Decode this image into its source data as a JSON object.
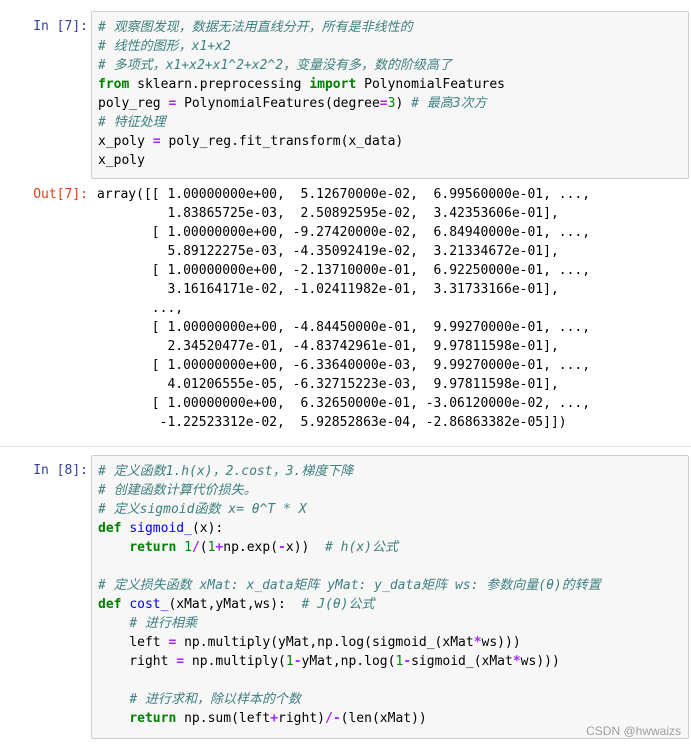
{
  "cells": [
    {
      "prompt": "In  [7]:",
      "lines": [
        [
          {
            "t": "cm",
            "v": "# 观察图发现，数据无法用直线分开，所有是非线性的"
          }
        ],
        [
          {
            "t": "cm",
            "v": "# 线性的图形，x1+x2"
          }
        ],
        [
          {
            "t": "cm",
            "v": "# 多项式，x1+x2+x1^2+x2^2，变量没有多，数的阶级高了"
          }
        ],
        [
          {
            "t": "kw",
            "v": "from"
          },
          {
            "t": "",
            "v": " sklearn.preprocessing "
          },
          {
            "t": "kw",
            "v": "import"
          },
          {
            "t": "",
            "v": " PolynomialFeatures"
          }
        ],
        [
          {
            "t": "",
            "v": "poly_reg "
          },
          {
            "t": "op",
            "v": "="
          },
          {
            "t": "",
            "v": " PolynomialFeatures(degree"
          },
          {
            "t": "op",
            "v": "="
          },
          {
            "t": "nm",
            "v": "3"
          },
          {
            "t": "",
            "v": ") "
          },
          {
            "t": "cm",
            "v": "# 最高3次方"
          }
        ],
        [
          {
            "t": "cm",
            "v": "# 特征处理"
          }
        ],
        [
          {
            "t": "",
            "v": "x_poly "
          },
          {
            "t": "op",
            "v": "="
          },
          {
            "t": "",
            "v": " poly_reg.fit_transform(x_data)"
          }
        ],
        [
          {
            "t": "",
            "v": "x_poly"
          }
        ]
      ]
    },
    {
      "prompt": "Out[7]:",
      "output": "array([[ 1.00000000e+00,  5.12670000e-02,  6.99560000e-01, ...,\n         1.83865725e-03,  2.50892595e-02,  3.42353606e-01],\n       [ 1.00000000e+00, -9.27420000e-02,  6.84940000e-01, ...,\n         5.89122275e-03, -4.35092419e-02,  3.21334672e-01],\n       [ 1.00000000e+00, -2.13710000e-01,  6.92250000e-01, ...,\n         3.16164171e-02, -1.02411982e-01,  3.31733166e-01],\n       ...,\n       [ 1.00000000e+00, -4.84450000e-01,  9.99270000e-01, ...,\n         2.34520477e-01, -4.83742961e-01,  9.97811598e-01],\n       [ 1.00000000e+00, -6.33640000e-03,  9.99270000e-01, ...,\n         4.01206555e-05, -6.32715223e-03,  9.97811598e-01],\n       [ 1.00000000e+00,  6.32650000e-01, -3.06120000e-02, ...,\n        -1.22523312e-02,  5.92852863e-04, -2.86863382e-05]])"
    },
    {
      "prompt": "In  [8]:",
      "lines": [
        [
          {
            "t": "cm",
            "v": "# 定义函数1.h(x)，2.cost，3.梯度下降"
          }
        ],
        [
          {
            "t": "cm",
            "v": "# 创建函数计算代价损失。"
          }
        ],
        [
          {
            "t": "cm",
            "v": "# 定义sigmoid函数 x= θ^T * X"
          }
        ],
        [
          {
            "t": "kw",
            "v": "def"
          },
          {
            "t": "",
            "v": " "
          },
          {
            "t": "fn",
            "v": "sigmoid_"
          },
          {
            "t": "",
            "v": "(x):"
          }
        ],
        [
          {
            "t": "",
            "v": "    "
          },
          {
            "t": "kw",
            "v": "return"
          },
          {
            "t": "",
            "v": " "
          },
          {
            "t": "nm",
            "v": "1"
          },
          {
            "t": "op",
            "v": "/"
          },
          {
            "t": "",
            "v": "("
          },
          {
            "t": "nm",
            "v": "1"
          },
          {
            "t": "op",
            "v": "+"
          },
          {
            "t": "",
            "v": "np.exp("
          },
          {
            "t": "op",
            "v": "-"
          },
          {
            "t": "",
            "v": "x))  "
          },
          {
            "t": "cm",
            "v": "# h(x)公式"
          }
        ],
        [
          {
            "t": "",
            "v": ""
          }
        ],
        [
          {
            "t": "cm",
            "v": "# 定义损失函数 xMat: x_data矩阵 yMat: y_data矩阵 ws: 参数向量(θ)的转置"
          }
        ],
        [
          {
            "t": "kw",
            "v": "def"
          },
          {
            "t": "",
            "v": " "
          },
          {
            "t": "fn",
            "v": "cost_"
          },
          {
            "t": "",
            "v": "(xMat,yMat,ws):  "
          },
          {
            "t": "cm",
            "v": "# J(θ)公式"
          }
        ],
        [
          {
            "t": "",
            "v": "    "
          },
          {
            "t": "cm",
            "v": "# 进行相乘"
          }
        ],
        [
          {
            "t": "",
            "v": "    left "
          },
          {
            "t": "op",
            "v": "="
          },
          {
            "t": "",
            "v": " np.multiply(yMat,np.log(sigmoid_(xMat"
          },
          {
            "t": "op",
            "v": "*"
          },
          {
            "t": "",
            "v": "ws)))"
          }
        ],
        [
          {
            "t": "",
            "v": "    right "
          },
          {
            "t": "op",
            "v": "="
          },
          {
            "t": "",
            "v": " np.multiply("
          },
          {
            "t": "nm",
            "v": "1"
          },
          {
            "t": "op",
            "v": "-"
          },
          {
            "t": "",
            "v": "yMat,np.log("
          },
          {
            "t": "nm",
            "v": "1"
          },
          {
            "t": "op",
            "v": "-"
          },
          {
            "t": "",
            "v": "sigmoid_(xMat"
          },
          {
            "t": "op",
            "v": "*"
          },
          {
            "t": "",
            "v": "ws)))"
          }
        ],
        [
          {
            "t": "",
            "v": ""
          }
        ],
        [
          {
            "t": "",
            "v": "    "
          },
          {
            "t": "cm",
            "v": "# 进行求和，除以样本的个数"
          }
        ],
        [
          {
            "t": "",
            "v": "    "
          },
          {
            "t": "kw",
            "v": "return"
          },
          {
            "t": "",
            "v": " np.sum(left"
          },
          {
            "t": "op",
            "v": "+"
          },
          {
            "t": "",
            "v": "right)"
          },
          {
            "t": "op",
            "v": "/-"
          },
          {
            "t": "",
            "v": "(len(xMat))"
          }
        ]
      ]
    }
  ],
  "watermark": "CSDN @hwwaizs"
}
